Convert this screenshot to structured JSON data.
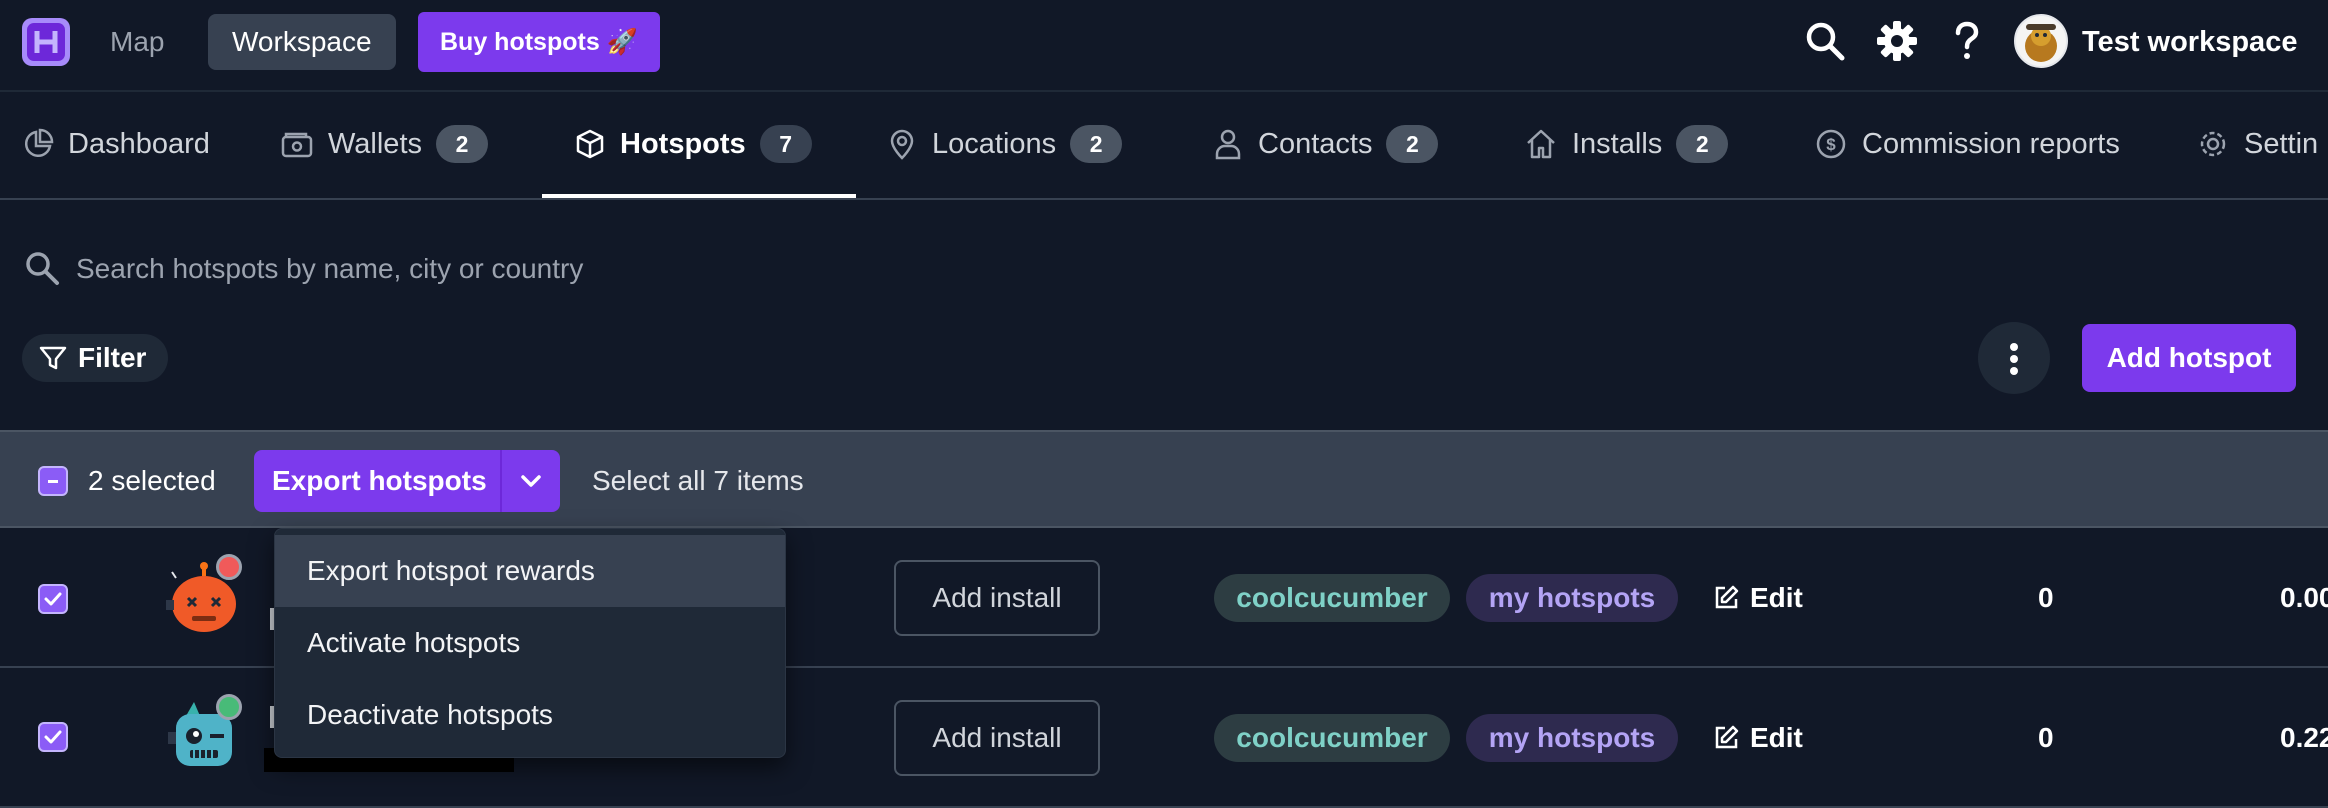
{
  "topbar": {
    "map_label": "Map",
    "workspace_label": "Workspace",
    "buy_label": "Buy hotspots 🚀",
    "workspace_name": "Test workspace",
    "icons": [
      "logo-icon",
      "search-icon",
      "gear-icon",
      "help-icon",
      "avatar"
    ]
  },
  "tabs": [
    {
      "label": "Dashboard",
      "icon": "chart-pie-icon"
    },
    {
      "label": "Wallets",
      "count": "2",
      "icon": "wallet-icon"
    },
    {
      "label": "Hotspots",
      "count": "7",
      "icon": "cube-icon",
      "active": true
    },
    {
      "label": "Locations",
      "count": "2",
      "icon": "map-pin-icon"
    },
    {
      "label": "Contacts",
      "count": "2",
      "icon": "user-icon"
    },
    {
      "label": "Installs",
      "count": "2",
      "icon": "home-icon"
    },
    {
      "label": "Commission reports",
      "icon": "dollar-circle-icon"
    },
    {
      "label": "Settin",
      "icon": "gear-icon"
    }
  ],
  "search": {
    "placeholder": "Search hotspots by name, city or country"
  },
  "toolbar": {
    "filter_label": "Filter",
    "add_label": "Add hotspot"
  },
  "selection": {
    "count_text": "2 selected",
    "export_label": "Export hotspots",
    "select_all_text": "Select all 7 items"
  },
  "dropdown": {
    "items": [
      "Export hotspot rewards",
      "Activate hotspots",
      "Deactivate hotspots"
    ]
  },
  "rows": [
    {
      "install_label": "Add install",
      "owner_tag": "coolcucumber",
      "group_tag": "my hotspots",
      "edit_label": "Edit",
      "value_a": "0",
      "value_b": "0.00",
      "checked": true,
      "status": "red"
    },
    {
      "install_label": "Add install",
      "owner_tag": "coolcucumber",
      "group_tag": "my hotspots",
      "edit_label": "Edit",
      "value_a": "0",
      "value_b": "0.22",
      "checked": true,
      "status": "green"
    }
  ],
  "colors": {
    "background": "#111827",
    "accent": "#7c3aed",
    "selection_bar": "#374151",
    "owner_tag_text": "#7fd1c7",
    "group_tag_text": "#b4a4f5"
  }
}
